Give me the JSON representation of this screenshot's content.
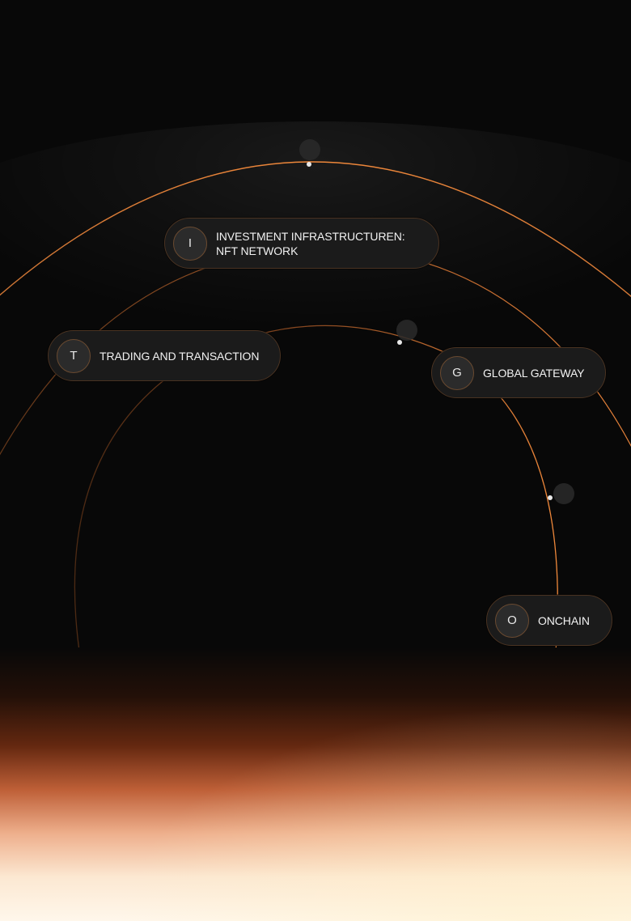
{
  "colors": {
    "background": "#080808",
    "accent_orange": "#e8833a",
    "pill_background": "#1b1b1b",
    "pill_border": "#4a3322"
  },
  "nodes": [
    {
      "id": "investment",
      "initial": "I",
      "label_lines": [
        "INVESTMENT INFRASTRUCTUREN:",
        "NFT NETWORK"
      ]
    },
    {
      "id": "trading",
      "initial": "T",
      "label_lines": [
        "TRADING AND TRANSACTION"
      ]
    },
    {
      "id": "global",
      "initial": "G",
      "label_lines": [
        "GLOBAL GATEWAY"
      ]
    },
    {
      "id": "onchain",
      "initial": "O",
      "label_lines": [
        "ONCHAIN"
      ]
    }
  ]
}
